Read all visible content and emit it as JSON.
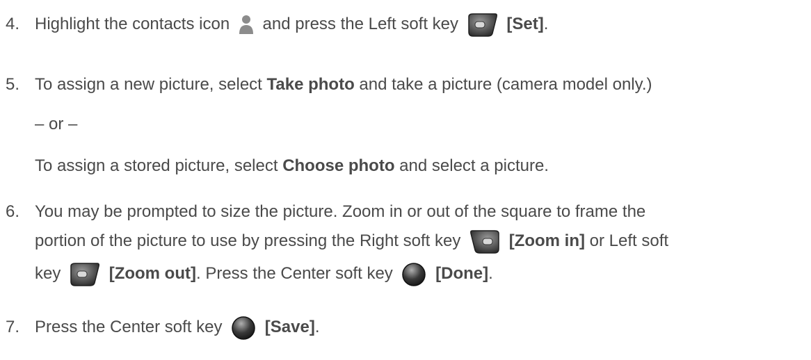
{
  "steps": [
    {
      "num": "4.",
      "t1": "Highlight the contacts icon",
      "t2": "and press the Left soft key",
      "b1": "[Set]",
      "t3": "."
    },
    {
      "num": "5.",
      "t1": "To assign a new picture, select",
      "b1": "Take photo",
      "t2": "and take a picture (camera model only.)",
      "or": "– or –",
      "t3": "To assign a stored picture, select",
      "b2": "Choose photo",
      "t4": "and select a picture."
    },
    {
      "num": "6.",
      "l1": "You may be prompted to size the picture. Zoom in or out of the square to frame the",
      "l2a": "portion of the picture to use by pressing the Right soft key",
      "b1": "[Zoom in]",
      "l2b": "or Left soft",
      "l3a": "key",
      "b2": "[Zoom out]",
      "l3b": ". Press the Center soft key",
      "b3": "[Done]",
      "l3c": "."
    },
    {
      "num": "7.",
      "t1": "Press the Center soft key",
      "b1": "[Save]",
      "t2": "."
    }
  ],
  "icons": {
    "contacts": "person-icon",
    "left_soft_key": "left-soft-key-icon",
    "right_soft_key": "right-soft-key-icon",
    "center_key": "center-key-icon"
  },
  "colors": {
    "text": "#4a4a4a",
    "key_dark": "#2b2b2b",
    "key_light": "#8a8a8a",
    "person": "#8c8c8c"
  }
}
